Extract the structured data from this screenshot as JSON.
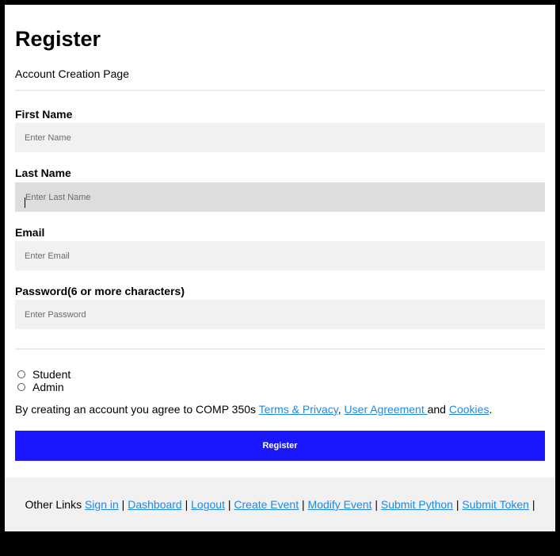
{
  "header": {
    "title": "Register",
    "subtitle": "Account Creation Page"
  },
  "form": {
    "first_name": {
      "label": "First Name",
      "placeholder": "Enter Name",
      "value": ""
    },
    "last_name": {
      "label": "Last Name",
      "placeholder": "Enter Last Name",
      "value": ""
    },
    "email": {
      "label": "Email",
      "placeholder": "Enter Email",
      "value": ""
    },
    "password": {
      "label": "Password(6 or more characters)",
      "placeholder": "Enter Password",
      "value": ""
    },
    "roles": [
      {
        "label": "Student",
        "selected": false
      },
      {
        "label": "Admin",
        "selected": false
      }
    ],
    "agreement": {
      "prefix": "By creating an account you agree to COMP 350s ",
      "terms": "Terms & Privacy",
      "comma": ", ",
      "user_agreement": "User Agreement ",
      "and": "and ",
      "cookies": "Cookies",
      "suffix": "."
    },
    "submit_label": "Register"
  },
  "footer": {
    "prefix": "Other Links ",
    "links": [
      "Sign in",
      "Dashboard",
      "Logout",
      "Create Event",
      "Modify Event",
      "Submit Python",
      "Submit Token"
    ],
    "separator": " | "
  },
  "colors": {
    "primary_button": "#1a17ff",
    "link": "#1e88e5",
    "input_bg": "#f1f1f1",
    "input_focus_bg": "#dddddd"
  }
}
